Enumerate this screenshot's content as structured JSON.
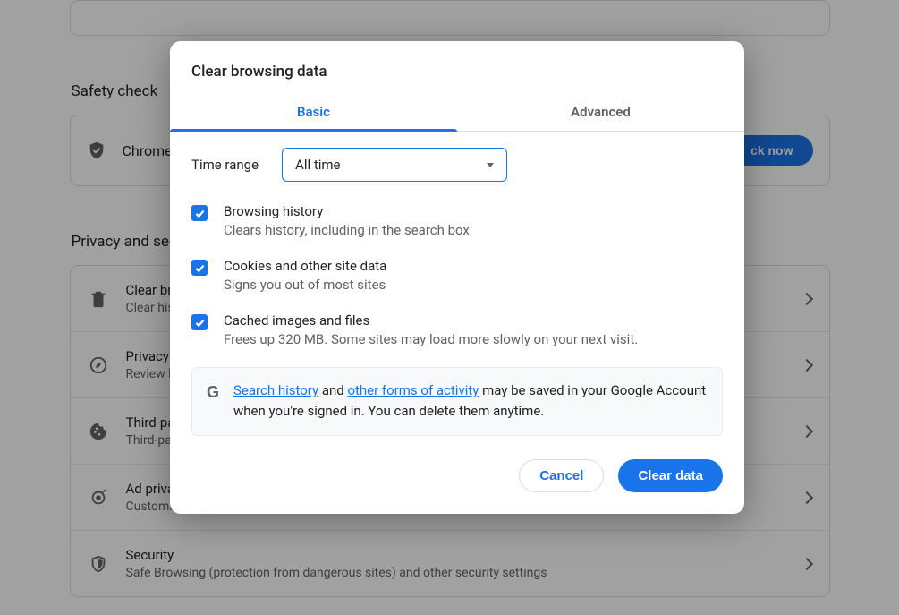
{
  "background": {
    "safety_check_heading": "Safety check",
    "safety_text": "Chrome",
    "check_now_label": "ck now",
    "privacy_heading": "Privacy and security",
    "rows": [
      {
        "title": "Clear browsing data",
        "sub": "Clear history, cookies, cache, and more"
      },
      {
        "title": "Privacy Guide",
        "sub": "Review key privacy and security controls"
      },
      {
        "title": "Third-party cookies",
        "sub": "Third-party cookies are blocked"
      },
      {
        "title": "Ad privacy",
        "sub": "Customize ad privacy"
      },
      {
        "title": "Security",
        "sub": "Safe Browsing (protection from dangerous sites) and other security settings"
      }
    ]
  },
  "modal": {
    "title": "Clear browsing data",
    "tabs": {
      "basic": "Basic",
      "advanced": "Advanced"
    },
    "time_range_label": "Time range",
    "time_range_value": "All time",
    "items": [
      {
        "title": "Browsing history",
        "sub": "Clears history, including in the search box"
      },
      {
        "title": "Cookies and other site data",
        "sub": "Signs you out of most sites"
      },
      {
        "title": "Cached images and files",
        "sub": "Frees up 320 MB. Some sites may load more slowly on your next visit."
      }
    ],
    "info": {
      "link1": "Search history",
      "mid1": " and ",
      "link2": "other forms of activity",
      "rest": " may be saved in your Google Account when you're signed in. You can delete them anytime."
    },
    "cancel_label": "Cancel",
    "clear_label": "Clear data"
  }
}
